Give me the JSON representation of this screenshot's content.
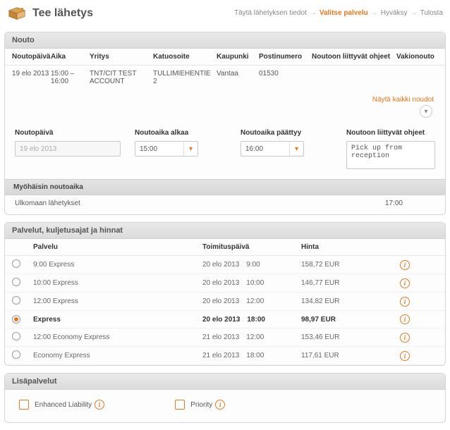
{
  "header": {
    "title": "Tee lähetys",
    "breadcrumb": {
      "step1": "Täytä lähetyksen tiedot",
      "step2": "Valitse palvelu",
      "step3": "Hyväksy",
      "step4": "Tulosta"
    }
  },
  "nouto": {
    "panel_title": "Nouto",
    "headers": {
      "date": "Noutopäivä",
      "time": "Aika",
      "company": "Yritys",
      "street": "Katuosoite",
      "city": "Kaupunki",
      "postal": "Postinumero",
      "instructions": "Noutoon liittyvät ohjeet",
      "default": "Vakionouto"
    },
    "row": {
      "date": "19 elo 2013",
      "time": "15:00 – 16:00",
      "company": "TNT/CIT TEST ACCOUNT",
      "street": "TULLIMIEHENTIE 2",
      "city": "Vantaa",
      "postal": "01530"
    },
    "show_all": "Näytä kaikki noudot",
    "form": {
      "date_label": "Noutopäivä",
      "date_value": "19 elo 2013",
      "start_label": "Noutoaika alkaa",
      "start_value": "15:00",
      "end_label": "Noutoaika päättyy",
      "end_value": "16:00",
      "instr_label": "Noutoon liittyvät ohjeet",
      "instr_value": "Pick up from reception"
    },
    "latest": {
      "header": "Myöhäisin noutoaika",
      "label": "Ulkomaan lähetykset",
      "value": "17:00"
    }
  },
  "services": {
    "panel_title": "Palvelut, kuljetusajat ja hinnat",
    "headers": {
      "service": "Palvelu",
      "delivery": "Toimituspäivä",
      "price": "Hinta"
    },
    "rows": [
      {
        "name": "9:00 Express",
        "date": "20 elo 2013",
        "time": "9:00",
        "price": "158,72 EUR",
        "selected": false
      },
      {
        "name": "10:00 Express",
        "date": "20 elo 2013",
        "time": "10:00",
        "price": "146,77 EUR",
        "selected": false
      },
      {
        "name": "12:00 Express",
        "date": "20 elo 2013",
        "time": "12:00",
        "price": "134,82 EUR",
        "selected": false
      },
      {
        "name": "Express",
        "date": "20 elo 2013",
        "time": "18:00",
        "price": "98,97 EUR",
        "selected": true
      },
      {
        "name": "12:00 Economy Express",
        "date": "21 elo 2013",
        "time": "12:00",
        "price": "153,46 EUR",
        "selected": false
      },
      {
        "name": "Economy Express",
        "date": "21 elo 2013",
        "time": "18:00",
        "price": "117,61 EUR",
        "selected": false
      }
    ]
  },
  "extras": {
    "panel_title": "Lisäpalvelut",
    "options": {
      "enhanced": "Enhanced Liability",
      "priority": "Priority"
    }
  }
}
